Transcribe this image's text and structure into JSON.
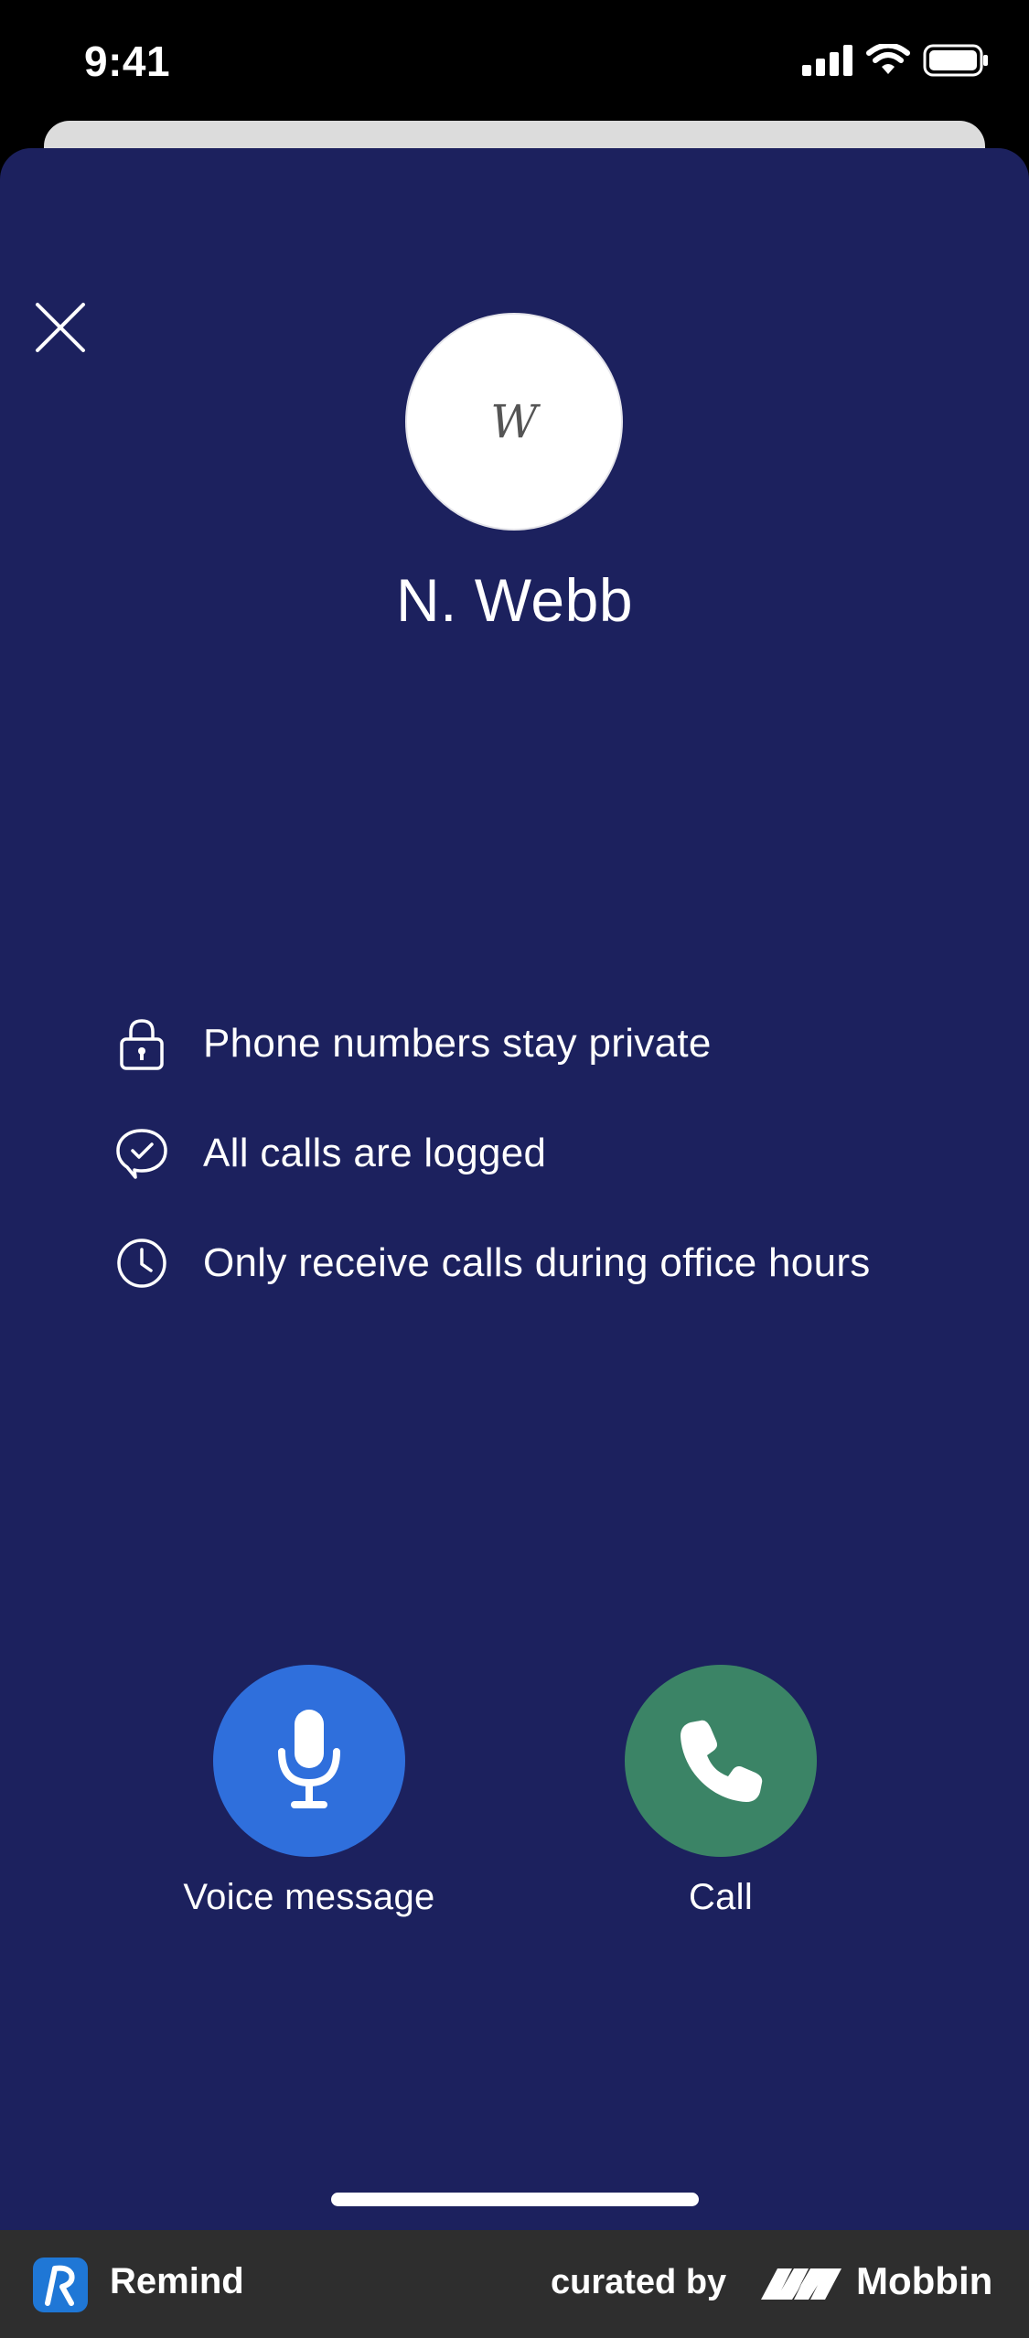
{
  "status_bar": {
    "time": "9:41"
  },
  "contact": {
    "avatar_initial": "W",
    "name": "N. Webb"
  },
  "features": [
    {
      "icon": "lock-icon",
      "text": "Phone numbers stay private"
    },
    {
      "icon": "chat-check-icon",
      "text": "All calls are logged"
    },
    {
      "icon": "clock-icon",
      "text": "Only receive calls during office hours"
    }
  ],
  "actions": {
    "voice": {
      "label": "Voice message",
      "icon": "microphone-icon",
      "color": "#2f6fdc"
    },
    "call": {
      "label": "Call",
      "icon": "phone-icon",
      "color": "#3b8466"
    }
  },
  "footer": {
    "app_name": "Remind",
    "curated_by": "curated by",
    "brand": "Mobbin"
  },
  "colors": {
    "sheet_background": "#1c215e",
    "footer_background": "#2e2e2e",
    "remind_blue": "#1f77d6"
  }
}
